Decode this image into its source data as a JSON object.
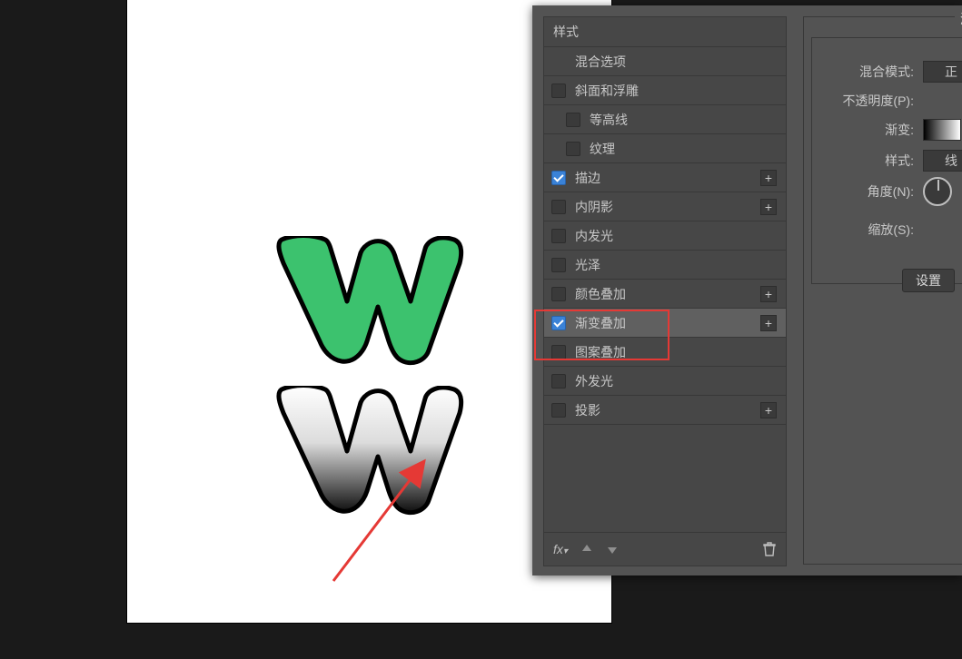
{
  "dialog": {
    "section_title": "渐变叠加",
    "subsection_title": "渐变",
    "styles_header": "样式",
    "items": [
      {
        "id": "blend-options",
        "label": "混合选项",
        "checkbox": "none",
        "plus": false,
        "indent": 0
      },
      {
        "id": "bevel-emboss",
        "label": "斜面和浮雕",
        "checkbox": "off",
        "plus": false,
        "indent": 0
      },
      {
        "id": "contour",
        "label": "等高线",
        "checkbox": "off",
        "plus": false,
        "indent": 1
      },
      {
        "id": "texture",
        "label": "纹理",
        "checkbox": "off",
        "plus": false,
        "indent": 1
      },
      {
        "id": "stroke",
        "label": "描边",
        "checkbox": "on",
        "plus": true,
        "indent": 0
      },
      {
        "id": "inner-shadow",
        "label": "内阴影",
        "checkbox": "off",
        "plus": true,
        "indent": 0
      },
      {
        "id": "inner-glow",
        "label": "内发光",
        "checkbox": "off",
        "plus": false,
        "indent": 0
      },
      {
        "id": "satin",
        "label": "光泽",
        "checkbox": "off",
        "plus": false,
        "indent": 0
      },
      {
        "id": "color-overlay",
        "label": "颜色叠加",
        "checkbox": "off",
        "plus": true,
        "indent": 0
      },
      {
        "id": "gradient-overlay",
        "label": "渐变叠加",
        "checkbox": "on",
        "plus": true,
        "indent": 0,
        "selected": true
      },
      {
        "id": "pattern-overlay",
        "label": "图案叠加",
        "checkbox": "off",
        "plus": false,
        "indent": 0
      },
      {
        "id": "outer-glow",
        "label": "外发光",
        "checkbox": "off",
        "plus": false,
        "indent": 0
      },
      {
        "id": "drop-shadow",
        "label": "投影",
        "checkbox": "off",
        "plus": true,
        "indent": 0
      }
    ],
    "footer": {
      "fx_label": "fx"
    },
    "params": {
      "blend_mode_label": "混合模式:",
      "blend_mode_value": "正",
      "opacity_label": "不透明度(P):",
      "gradient_label": "渐变:",
      "style_label": "样式:",
      "style_value": "线",
      "angle_label": "角度(N):",
      "scale_label": "缩放(S):",
      "defaults_btn": "设置"
    }
  },
  "canvas": {
    "top_fill": "#38b86a",
    "stroke": "#000000"
  }
}
